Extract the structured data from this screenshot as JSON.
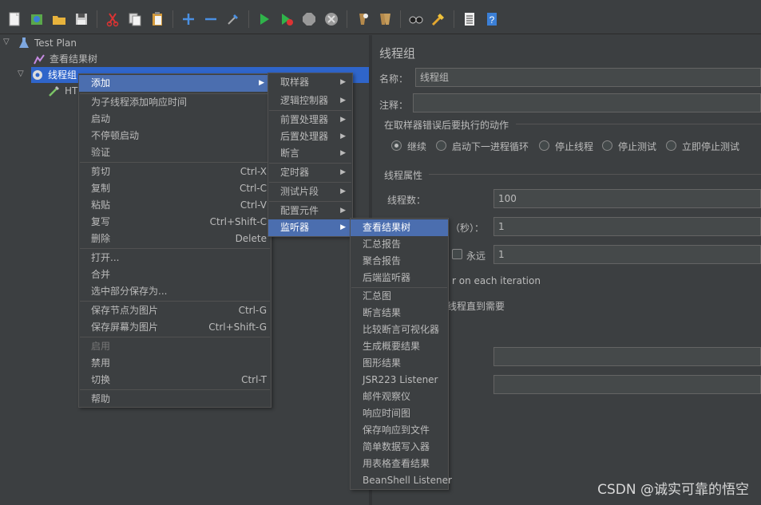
{
  "toolbar": {
    "icons": [
      "new-icon",
      "templates-icon",
      "open-icon",
      "save-icon",
      "cut-icon",
      "copy-icon",
      "paste-icon",
      "expand-icon",
      "collapse-icon",
      "toggle-icon",
      "start-icon",
      "start-no-pause-icon",
      "stop-icon",
      "shutdown-icon",
      "clear-icon",
      "clear-all-icon",
      "search-icon",
      "reset-search-icon",
      "function-helper-icon",
      "help-icon"
    ]
  },
  "tree": {
    "items": [
      {
        "label": "Test Plan"
      },
      {
        "label": "查看结果树"
      },
      {
        "label": "线程组"
      },
      {
        "label": "HT"
      }
    ]
  },
  "panel": {
    "title": "线程组",
    "name_label": "名称：",
    "name_value": "线程组",
    "comment_label": "注释：",
    "on_error_title": "在取样器错误后要执行的动作",
    "actions": [
      "继续",
      "启动下一进程循环",
      "停止线程",
      "停止测试",
      "立即停止测试"
    ],
    "thread_props_title": "线程属性",
    "threads_label": "线程数：",
    "threads_value": "100",
    "rampup_label": "（秒）：",
    "rampup_value": "1",
    "forever_label": "永远",
    "loop_value": "1",
    "same_user_text": "r on each iteration",
    "delay_text": "线程直到需要"
  },
  "menu1": {
    "items": [
      {
        "label": "添加",
        "shortcut": ""
      },
      {
        "label": "为子线程添加响应时间",
        "shortcut": ""
      },
      {
        "label": "启动",
        "shortcut": ""
      },
      {
        "label": "不停顿启动",
        "shortcut": ""
      },
      {
        "label": "验证",
        "shortcut": ""
      },
      {
        "label": "剪切",
        "shortcut": "Ctrl-X"
      },
      {
        "label": "复制",
        "shortcut": "Ctrl-C"
      },
      {
        "label": "粘贴",
        "shortcut": "Ctrl-V"
      },
      {
        "label": "复写",
        "shortcut": "Ctrl+Shift-C"
      },
      {
        "label": "删除",
        "shortcut": "Delete"
      },
      {
        "label": "打开...",
        "shortcut": ""
      },
      {
        "label": "合并",
        "shortcut": ""
      },
      {
        "label": "选中部分保存为...",
        "shortcut": ""
      },
      {
        "label": "保存节点为图片",
        "shortcut": "Ctrl-G"
      },
      {
        "label": "保存屏幕为图片",
        "shortcut": "Ctrl+Shift-G"
      },
      {
        "label": "启用",
        "shortcut": ""
      },
      {
        "label": "禁用",
        "shortcut": ""
      },
      {
        "label": "切换",
        "shortcut": "Ctrl-T"
      },
      {
        "label": "帮助",
        "shortcut": ""
      }
    ]
  },
  "menu2": {
    "items": [
      {
        "label": "取样器"
      },
      {
        "label": "逻辑控制器"
      },
      {
        "label": "前置处理器"
      },
      {
        "label": "后置处理器"
      },
      {
        "label": "断言"
      },
      {
        "label": "定时器"
      },
      {
        "label": "测试片段"
      },
      {
        "label": "配置元件"
      },
      {
        "label": "监听器"
      }
    ]
  },
  "menu3": {
    "items": [
      {
        "label": "查看结果树"
      },
      {
        "label": "汇总报告"
      },
      {
        "label": "聚合报告"
      },
      {
        "label": "后端监听器"
      },
      {
        "label": "汇总图"
      },
      {
        "label": "断言结果"
      },
      {
        "label": "比较断言可视化器"
      },
      {
        "label": "生成概要结果"
      },
      {
        "label": "图形结果"
      },
      {
        "label": "JSR223 Listener"
      },
      {
        "label": "邮件观察仪"
      },
      {
        "label": "响应时间图"
      },
      {
        "label": "保存响应到文件"
      },
      {
        "label": "简单数据写入器"
      },
      {
        "label": "用表格查看结果"
      },
      {
        "label": "BeanShell Listener"
      }
    ]
  },
  "watermark": "CSDN @诚实可靠的悟空",
  "colors": {
    "background": "#3c3f41",
    "highlight": "#4b6eaf",
    "tree_selected": "#2f65ca",
    "text": "#bbbbbb"
  }
}
